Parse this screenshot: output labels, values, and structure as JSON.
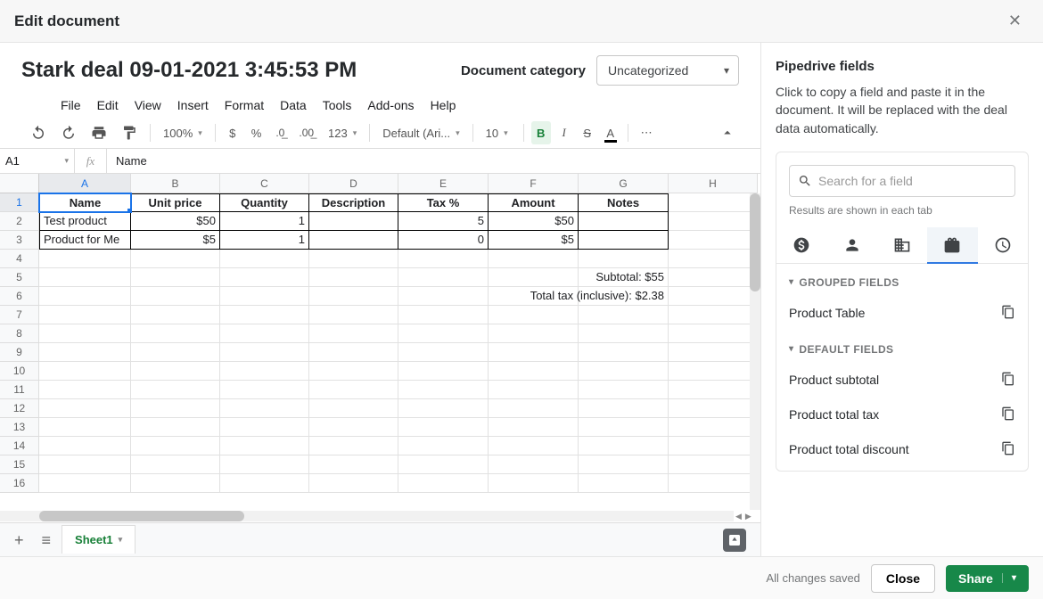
{
  "modal_title": "Edit document",
  "doc_title": "Stark deal 09-01-2021 3:45:53 PM",
  "category_label": "Document category",
  "category_value": "Uncategorized",
  "menus": [
    "File",
    "Edit",
    "View",
    "Insert",
    "Format",
    "Data",
    "Tools",
    "Add-ons",
    "Help"
  ],
  "toolbar": {
    "zoom": "100%",
    "font": "Default (Ari...",
    "font_size": "10",
    "num_fmt": "123"
  },
  "cell_ref": "A1",
  "fx_icon": "fx",
  "formula_value": "Name",
  "columns": [
    "A",
    "B",
    "C",
    "D",
    "E",
    "F",
    "G",
    "H"
  ],
  "header_row": [
    "Name",
    "Unit price",
    "Quantity",
    "Description",
    "Tax %",
    "Amount",
    "Notes"
  ],
  "data_rows": [
    {
      "name": "Test product",
      "unit_price": "$50",
      "quantity": "1",
      "description": "",
      "tax": "5",
      "amount": "$50",
      "notes": ""
    },
    {
      "name": "Product for Me",
      "unit_price": "$5",
      "quantity": "1",
      "description": "",
      "tax": "0",
      "amount": "$5",
      "notes": ""
    }
  ],
  "subtotal_label": "Subtotal: $55",
  "total_tax_label": "Total tax (inclusive): $2.38",
  "sheet_tab": "Sheet1",
  "side": {
    "title": "Pipedrive fields",
    "desc": "Click to copy a field and paste it in the document. It will be replaced with the deal data automatically.",
    "search_placeholder": "Search for a field",
    "results_hint": "Results are shown in each tab",
    "grouped_label": "GROUPED FIELDS",
    "default_label": "DEFAULT FIELDS",
    "grouped": [
      "Product Table"
    ],
    "default": [
      "Product subtotal",
      "Product total tax",
      "Product total discount"
    ]
  },
  "footer": {
    "saved": "All changes saved",
    "close": "Close",
    "share": "Share"
  }
}
